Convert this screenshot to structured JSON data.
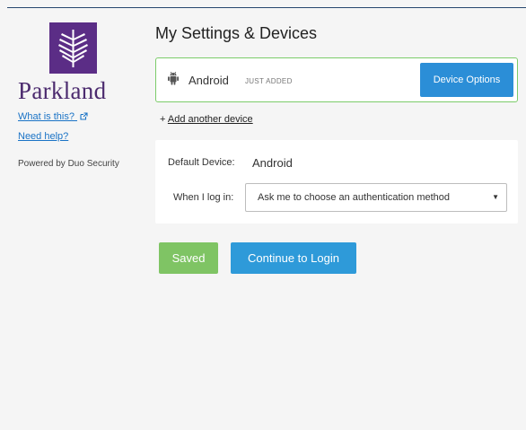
{
  "sidebar": {
    "brand": "Parkland",
    "what_is_this": "What is this?",
    "need_help": "Need help?",
    "powered_by": "Powered by Duo Security",
    "logo_icon": "parkland-feather-logo",
    "external_icon": "external-link-icon"
  },
  "main": {
    "title": "My Settings & Devices",
    "device": {
      "icon": "android-icon",
      "name": "Android",
      "badge": "JUST ADDED",
      "options_label": "Device Options"
    },
    "add_device_prefix": "+ ",
    "add_device_label": "Add another device",
    "settings": {
      "default_device_label": "Default Device:",
      "default_device_value": "Android",
      "when_login_label": "When I log in:",
      "when_login_value": "Ask me to choose an authentication method"
    },
    "saved_label": "Saved",
    "continue_label": "Continue to Login"
  },
  "colors": {
    "brand_purple": "#5b2d86",
    "primary_blue": "#2e9ad9",
    "success_green": "#7fc464",
    "card_border_green": "#7ccc6a"
  }
}
